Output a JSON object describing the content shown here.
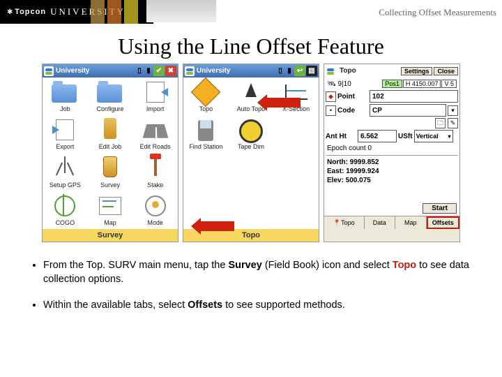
{
  "header": {
    "brand_small": "Topcon",
    "brand": "UNIVERSITY",
    "right": "Collecting Offset Measurements"
  },
  "title": "Using the Line Offset Feature",
  "screen1": {
    "titlebar": "University",
    "footer": "Survey",
    "cells": [
      "Job",
      "Configure",
      "Import",
      "Export",
      "Edit Job",
      "Edit Roads",
      "Setup GPS",
      "Survey",
      "Stake",
      "COGO",
      "Map",
      "Mode"
    ]
  },
  "screen2": {
    "titlebar": "University",
    "footer": "Topo",
    "cells": [
      "Topo",
      "Auto Topo",
      "X-Section",
      "Find Station",
      "Tape Dim",
      "",
      "",
      "",
      "",
      "",
      "",
      ""
    ]
  },
  "screen3": {
    "titlebar": "Topo",
    "settings": "Settings",
    "close": "Close",
    "sat_ratio": "9|10",
    "pos1": "Pos1",
    "h": "H",
    "v": "V",
    "h_val": "4150.007",
    "v_val": "5",
    "point_label": "Point",
    "point_val": "102",
    "code_label": "Code",
    "code_val": "CP",
    "ant_label": "Ant Ht",
    "ant_val": "6.562",
    "ant_unit": "USft",
    "vert": "Vertical",
    "epoch": "Epoch count 0",
    "north": "North: 9999.852",
    "east": "East: 19999.924",
    "elev": "Elev: 500.075",
    "start": "Start",
    "tabs": [
      "Topo",
      "Data",
      "Map",
      "Offsets"
    ]
  },
  "bullets": {
    "b1_a": "From the Top. SURV main menu, tap the ",
    "b1_survey": "Survey",
    "b1_b": " (Field Book) icon and select ",
    "b1_topo": "Topo",
    "b1_c": " to see data collection options.",
    "b2_a": "Within the available tabs, select ",
    "b2_offsets": "Offsets",
    "b2_b": " to see supported methods."
  }
}
